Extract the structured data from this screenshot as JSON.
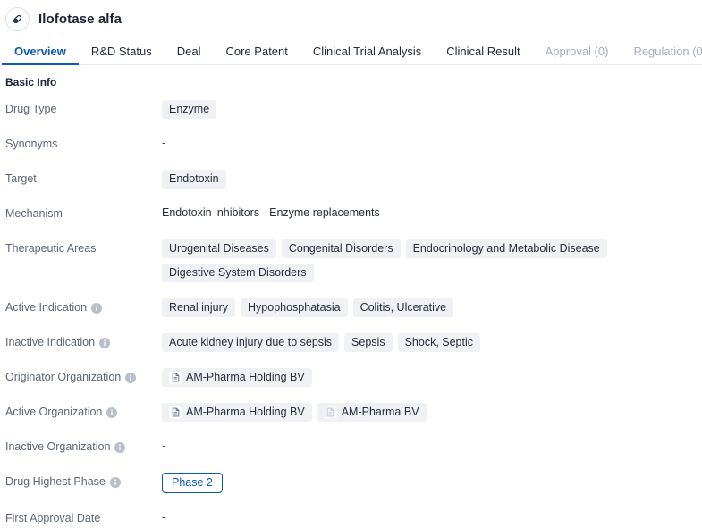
{
  "header": {
    "title": "Ilofotase alfa",
    "avatar_icon": "capsule-pill-icon"
  },
  "tabs": [
    {
      "label": "Overview",
      "active": true,
      "disabled": false
    },
    {
      "label": "R&D Status",
      "active": false,
      "disabled": false
    },
    {
      "label": "Deal",
      "active": false,
      "disabled": false
    },
    {
      "label": "Core Patent",
      "active": false,
      "disabled": false
    },
    {
      "label": "Clinical Trial Analysis",
      "active": false,
      "disabled": false
    },
    {
      "label": "Clinical Result",
      "active": false,
      "disabled": false
    },
    {
      "label": "Approval (0)",
      "active": false,
      "disabled": true
    },
    {
      "label": "Regulation (0)",
      "active": false,
      "disabled": true
    }
  ],
  "section": {
    "title": "Basic Info"
  },
  "rows": {
    "drug_type": {
      "label": "Drug Type",
      "info": false,
      "chips": [
        "Enzyme"
      ]
    },
    "synonyms": {
      "label": "Synonyms",
      "info": false,
      "empty": "-"
    },
    "target": {
      "label": "Target",
      "info": false,
      "chips": [
        "Endotoxin"
      ]
    },
    "mechanism": {
      "label": "Mechanism",
      "info": false,
      "items": [
        "Endotoxin inhibitors",
        "Enzyme replacements"
      ]
    },
    "therapeutic_areas": {
      "label": "Therapeutic Areas",
      "info": false,
      "chips": [
        "Urogenital Diseases",
        "Congenital Disorders",
        "Endocrinology and Metabolic Disease",
        "Digestive System Disorders"
      ]
    },
    "active_indication": {
      "label": "Active Indication",
      "info": true,
      "chips": [
        "Renal injury",
        "Hypophosphatasia",
        "Colitis, Ulcerative"
      ]
    },
    "inactive_indication": {
      "label": "Inactive Indication",
      "info": true,
      "chips": [
        "Acute kidney injury due to sepsis",
        "Sepsis",
        "Shock, Septic"
      ]
    },
    "originator_organization": {
      "label": "Originator Organization",
      "info": true,
      "orgs": [
        {
          "name": "AM-Pharma Holding BV",
          "icon": "organization-building-icon",
          "faded": false
        }
      ]
    },
    "active_organization": {
      "label": "Active Organization",
      "info": true,
      "orgs": [
        {
          "name": "AM-Pharma Holding BV",
          "icon": "organization-building-icon",
          "faded": false
        },
        {
          "name": "AM-Pharma BV",
          "icon": "organization-building-icon",
          "faded": true
        }
      ]
    },
    "inactive_organization": {
      "label": "Inactive Organization",
      "info": true,
      "empty": "-"
    },
    "drug_highest_phase": {
      "label": "Drug Highest Phase",
      "info": true,
      "badge": "Phase 2"
    },
    "first_approval_date": {
      "label": "First Approval Date",
      "info": false,
      "empty": "-"
    }
  },
  "colors": {
    "accent": "#0a5bb5",
    "chip_bg": "#f0f1f4",
    "label_text": "#5c6679",
    "disabled_tab": "#a5adbb"
  }
}
